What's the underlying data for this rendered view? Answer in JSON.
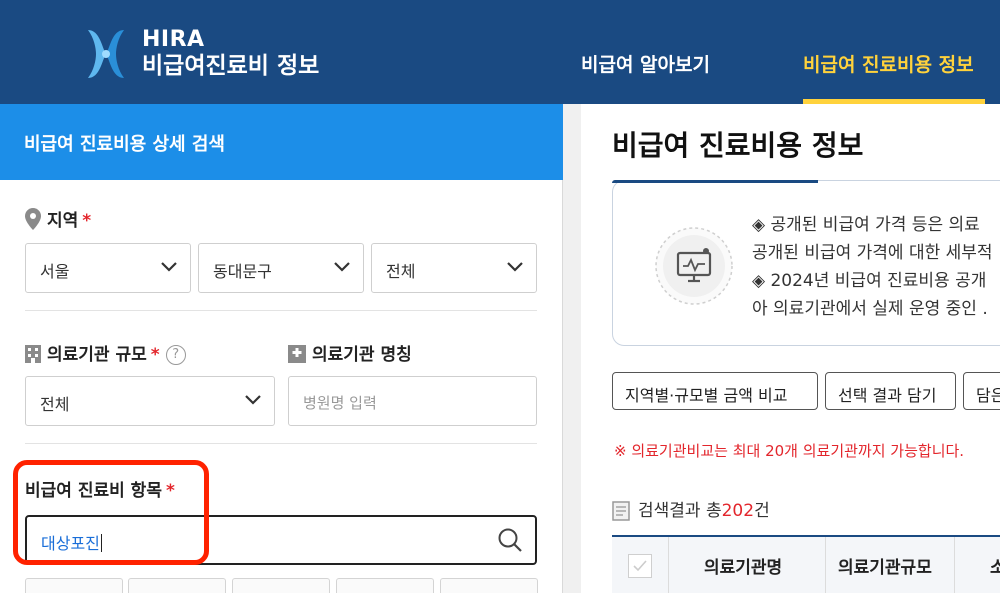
{
  "header": {
    "logo_en": "HIRA",
    "logo_ko": "비급여진료비 정보",
    "nav": [
      "비급여 알아보기",
      "비급여 진료비용 정보"
    ],
    "bg_color": "#1a4a82",
    "active_color": "#ffd23c"
  },
  "left": {
    "title": "비급여 진료비용 상세 검색",
    "region": {
      "label": "지역",
      "required": "*",
      "selects": [
        "서울",
        "동대문구",
        "전체"
      ]
    },
    "scale": {
      "label": "의료기관 규모",
      "required": "*",
      "help": "?",
      "value": "전체"
    },
    "name": {
      "label": "의료기관 명칭",
      "placeholder": "병원명 입력"
    },
    "item": {
      "label": "비급여 진료비 항목",
      "required": "*",
      "value": "대상포진"
    }
  },
  "right": {
    "title": "비급여 진료비용 정보",
    "notice_lines": [
      "◈ 공개된 비급여 가격 등은 의료",
      "공개된 비급여 가격에 대한 세부적",
      "◈ 2024년 비급여 진료비용 공개",
      "아 의료기관에서 실제 운영 중인 ."
    ],
    "buttons": [
      "지역별·규모별 금액 비교",
      "선택 결과 담기",
      "담은"
    ],
    "warning": "※ 의료기관비교는 최대 20개 의료기관까지 가능합니다.",
    "result_prefix": "검색결과 총",
    "result_count": "202",
    "result_suffix": "건",
    "table_headers": [
      "의료기관명",
      "의료기관규모",
      "소"
    ]
  },
  "icons": {
    "pin": "map-pin-icon",
    "hospital": "hospital-icon",
    "building": "building-icon",
    "search": "search-icon",
    "chevron": "chevron-down-icon",
    "doc": "document-icon",
    "computer": "computer-icon"
  }
}
